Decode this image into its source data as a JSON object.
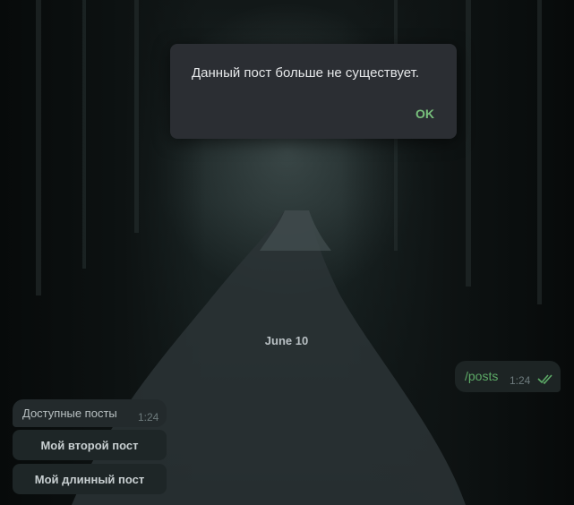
{
  "dialog": {
    "message": "Данный пост больше не существует.",
    "ok_label": "OK"
  },
  "chat": {
    "date_separator": "June 10",
    "outgoing": {
      "text": "/posts",
      "time": "1:24",
      "status_icon": "double-check-icon"
    },
    "incoming": {
      "text": "Доступные посты",
      "time": "1:24"
    },
    "keyboard_buttons": [
      "Мой второй пост",
      "Мой длинный пост"
    ]
  },
  "colors": {
    "dialog_bg": "#2b2e33",
    "accent_green": "#78c07c",
    "outgoing_text": "#5dab67"
  }
}
